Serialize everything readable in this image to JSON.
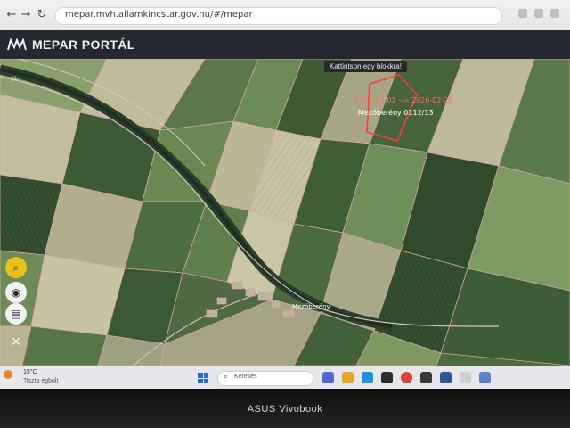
{
  "browser": {
    "url": "mepar.mvh.allamkincstar.gov.hu/#/mepar",
    "back_icon": "back-arrow-icon",
    "forward_icon": "forward-arrow-icon",
    "reload_icon": "reload-icon"
  },
  "app": {
    "title": "MEPAR PORTÁL",
    "logo_icon": "mepar-logo-icon"
  },
  "map": {
    "tooltip": "Kattintson egy blokkra!",
    "date_range": "2025-03-01 --> 2026-02-28",
    "selected_parcel": "Mezőberény 0112/13",
    "town": "Mezőberény",
    "tools": [
      "search-icon",
      "zoom-icon",
      "layers-icon",
      "print-icon",
      "close-icon"
    ],
    "colors": {
      "parcel_outline": "#e3a0a0",
      "selection": "#ff3b3b",
      "accent": "#e7c11b"
    }
  },
  "taskbar": {
    "weather_temp": "15°C",
    "weather_condition": "Tiszta égbolt",
    "search_placeholder": "Keresés"
  },
  "device": {
    "brand": "ASUS Vivobook"
  }
}
